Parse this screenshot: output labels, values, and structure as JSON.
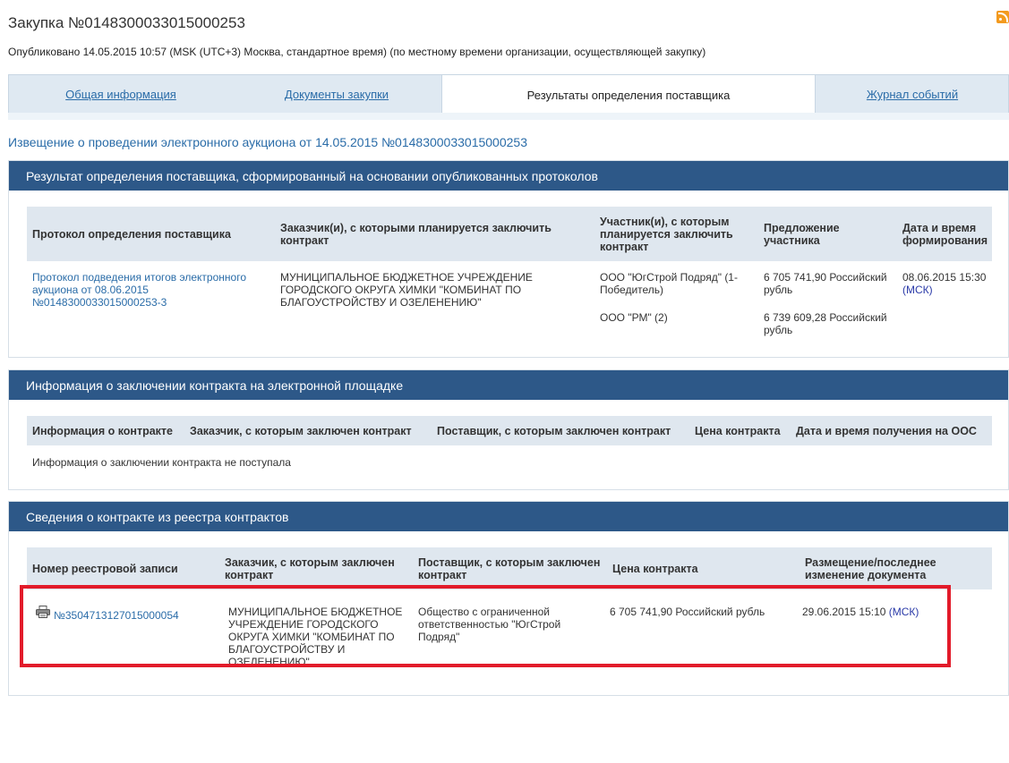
{
  "page": {
    "title": "Закупка №0148300033015000253",
    "published": "Опубликовано 14.05.2015 10:57 (MSK (UTC+3) Москва, стандартное время) (по местному времени организации, осуществляющей закупку)"
  },
  "tabs": [
    {
      "label": "Общая информация",
      "active": false
    },
    {
      "label": "Документы закупки",
      "active": false
    },
    {
      "label": "Результаты определения поставщика",
      "active": true
    },
    {
      "label": "Журнал событий",
      "active": false
    }
  ],
  "notice_link": "Извещение о проведении электронного аукциона от 14.05.2015 №0148300033015000253",
  "results_panel": {
    "title": "Результат определения поставщика, сформированный на основании опубликованных протоколов",
    "headers": [
      "Протокол определения поставщика",
      "Заказчик(и), с которыми планируется заключить контракт",
      "Участник(и), с которым планируется заключить контракт",
      "Предложение участника",
      "Дата и время формирования"
    ],
    "row": {
      "protocol": "Протокол подведения итогов электронного аукциона от 08.06.2015 №0148300033015000253-3",
      "customer": "МУНИЦИПАЛЬНОЕ БЮДЖЕТНОЕ УЧРЕЖДЕНИЕ ГОРОДСКОГО ОКРУГА ХИМКИ \"КОМБИНАТ ПО БЛАГОУСТРОЙСТВУ И ОЗЕЛЕНЕНИЮ\"",
      "participants": [
        {
          "name": "ООО \"ЮгСтрой Подряд\" (1-Победитель)",
          "offer": "6 705 741,90 Российский рубль"
        },
        {
          "name": "ООО \"РМ\" (2)",
          "offer": "6 739 609,28 Российский рубль"
        }
      ],
      "date": "08.06.2015 15:30",
      "tz": "(МСК)"
    }
  },
  "contract_panel": {
    "title": "Информация о заключении контракта на электронной площадке",
    "headers": [
      "Информация о контракте",
      "Заказчик, с которым заключен контракт",
      "Поставщик, с которым заключен контракт",
      "Цена контракта",
      "Дата и время получения на ООС"
    ],
    "empty": "Информация о заключении контракта не поступала"
  },
  "registry_panel": {
    "title": "Сведения о контракте из реестра контрактов",
    "headers": [
      "Номер реестровой записи",
      "Заказчик, с которым заключен контракт",
      "Поставщик, с которым заключен контракт",
      "Цена контракта",
      "Размещение/последнее изменение документа"
    ],
    "row": {
      "number": "№3504713127015000054",
      "customer": "МУНИЦИПАЛЬНОЕ БЮДЖЕТНОЕ УЧРЕЖДЕНИЕ ГОРОДСКОГО ОКРУГА ХИМКИ \"КОМБИНАТ ПО БЛАГОУСТРОЙСТВУ И ОЗЕЛЕНЕНИЮ\"",
      "supplier": "Общество с ограниченной ответственностью \"ЮгСтрой Подряд\"",
      "price": "6 705 741,90 Российский рубль",
      "date": "29.06.2015 15:10",
      "tz": "(МСК)"
    }
  },
  "colors": {
    "panel_header": "#2d5888",
    "link": "#2a6ca8",
    "highlight": "#e21b2a"
  }
}
